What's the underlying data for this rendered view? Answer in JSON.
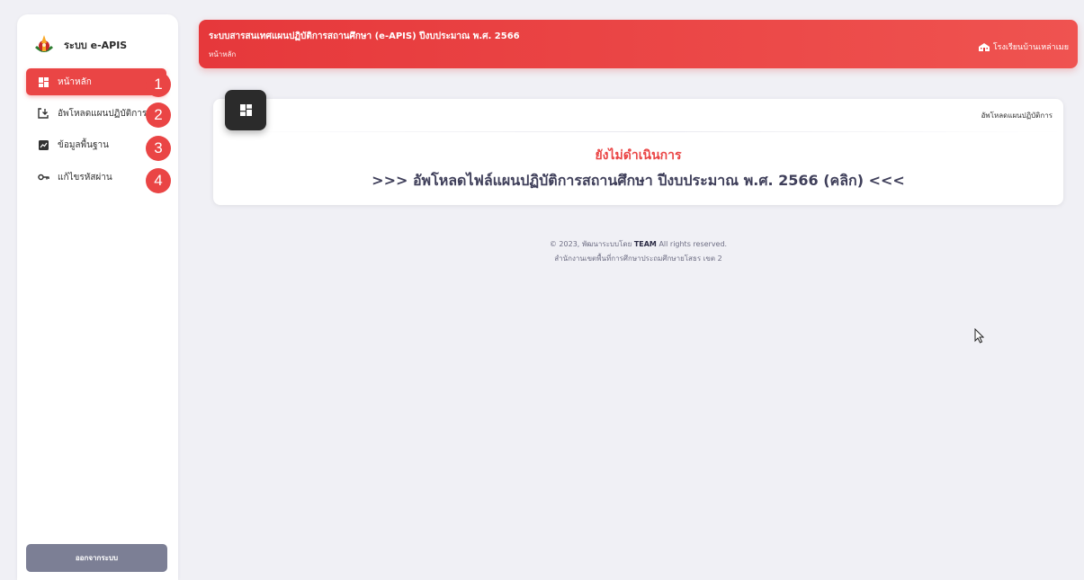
{
  "sidebar": {
    "brand": "ระบบ e-APIS",
    "items": [
      {
        "label": "หน้าหลัก",
        "badge": "1",
        "icon": "dashboard-icon",
        "active": true
      },
      {
        "label": "อัพโหลดแผนปฏิบัติการ",
        "badge": "2",
        "icon": "upload-icon",
        "active": false
      },
      {
        "label": "ข้อมูลพื้นฐาน",
        "badge": "3",
        "icon": "chart-icon",
        "active": false
      },
      {
        "label": "แก้ไขรหัสผ่าน",
        "badge": "4",
        "icon": "key-icon",
        "active": false
      }
    ],
    "logout_label": "ออกจากระบบ"
  },
  "header": {
    "title": "ระบบสารสนเทศแผนปฏิบัติการสถานศึกษา (e-APIS) ปีงบประมาณ พ.ศ. 2566",
    "breadcrumb": "หน้าหลัก",
    "school": "โรงเรียนบ้านเหล่าเมย"
  },
  "card": {
    "top_right": "อัพโหลดแผนปฏิบัติการ",
    "status": "ยังไม่ดำเนินการ",
    "link": ">>> อัพโหลดไฟล์แผนปฏิบัติการสถานศึกษา ปีงบประมาณ พ.ศ. 2566 (คลิก) <<<"
  },
  "footer": {
    "line1_prefix": "© 2023, พัฒนาระบบโดย",
    "line1_team": "TEAM",
    "line1_suffix": "All rights reserved.",
    "line2": "สำนักงานเขตพื้นที่การศึกษาประถมศึกษายโสธร เขต 2"
  },
  "colors": {
    "accent": "#ea4545",
    "header_end": "#ef5350",
    "logout": "#7c7f95",
    "background": "#f0f0f5"
  }
}
